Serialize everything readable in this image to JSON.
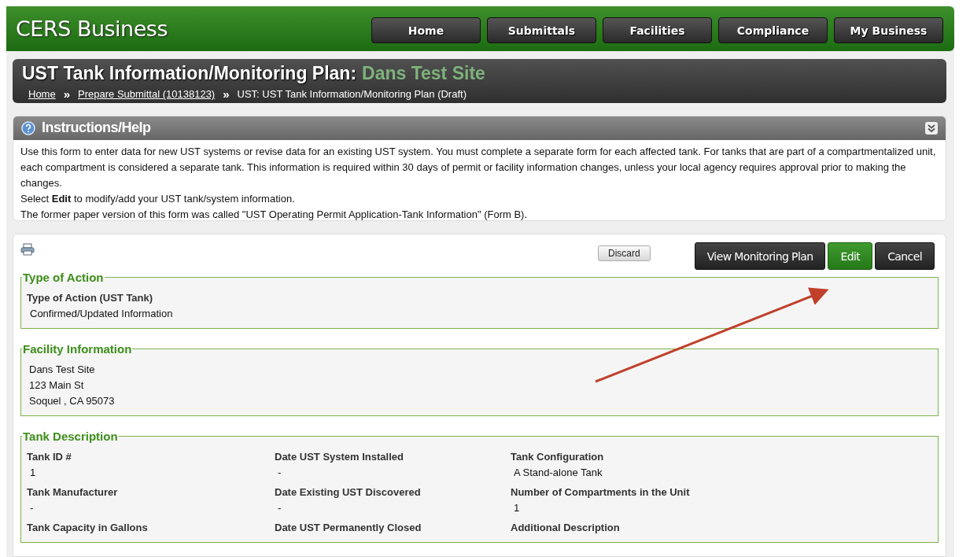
{
  "header": {
    "logo": "CERS Business",
    "nav": [
      {
        "label": "Home"
      },
      {
        "label": "Submittals"
      },
      {
        "label": "Facilities"
      },
      {
        "label": "Compliance"
      },
      {
        "label": "My Business"
      }
    ]
  },
  "page_title": {
    "prefix": "UST Tank Information/Monitoring Plan:",
    "site": "Dans Test Site"
  },
  "breadcrumb": [
    {
      "kind": "link",
      "label": "Home"
    },
    {
      "kind": "separator",
      "label": "»"
    },
    {
      "kind": "link",
      "label": "Prepare Submittal (10138123)"
    },
    {
      "kind": "separator",
      "label": "»"
    },
    {
      "kind": "current",
      "label": "UST: UST Tank Information/Monitoring Plan (Draft)"
    }
  ],
  "instructions": {
    "title": "Instructions/Help",
    "expanded": true,
    "paragraphs": [
      "Use this form to enter data for new UST systems or revise data for an existing UST system. You must complete a separate form for each affected tank. For tanks that are part of a compartmentalized unit, each compartment is considered a separate tank. This information is required within 30 days of permit or facility information changes, unless your local agency requires approval prior to making the changes.",
      "Select **Edit** to modify/add your UST tank/system information.",
      "The former paper version of this form was called \"UST Operating Permit Application-Tank Information\" (Form B)."
    ]
  },
  "toolbar": {
    "discard": "Discard",
    "buttons": [
      {
        "label": "View Monitoring Plan",
        "kind": "dark"
      },
      {
        "label": "Edit",
        "kind": "primary"
      },
      {
        "label": "Cancel",
        "kind": "dark"
      }
    ]
  },
  "sections": [
    {
      "title": "Type of Action",
      "kind": "fields",
      "fields": [
        {
          "label": "Type of Action (UST Tank)",
          "value": "Confirmed/Updated Information"
        }
      ]
    },
    {
      "title": "Facility Information",
      "kind": "address",
      "lines": [
        "Dans Test Site",
        "123 Main St",
        "Soquel ,  CA  95073"
      ]
    },
    {
      "title": "Tank Description",
      "kind": "grid",
      "fields": [
        {
          "label": "Tank ID #",
          "value": "1"
        },
        {
          "label": "Date UST System Installed",
          "value": "-"
        },
        {
          "label": "Tank Configuration",
          "value": "A Stand-alone Tank"
        },
        {
          "label": "Tank Manufacturer",
          "value": "-"
        },
        {
          "label": "Date Existing UST Discovered",
          "value": "-"
        },
        {
          "label": "Number of Compartments in the Unit",
          "value": "1"
        },
        {
          "label": "Tank Capacity in Gallons"
        },
        {
          "label": "Date UST Permanently Closed"
        },
        {
          "label": "Additional Description"
        }
      ]
    }
  ]
}
